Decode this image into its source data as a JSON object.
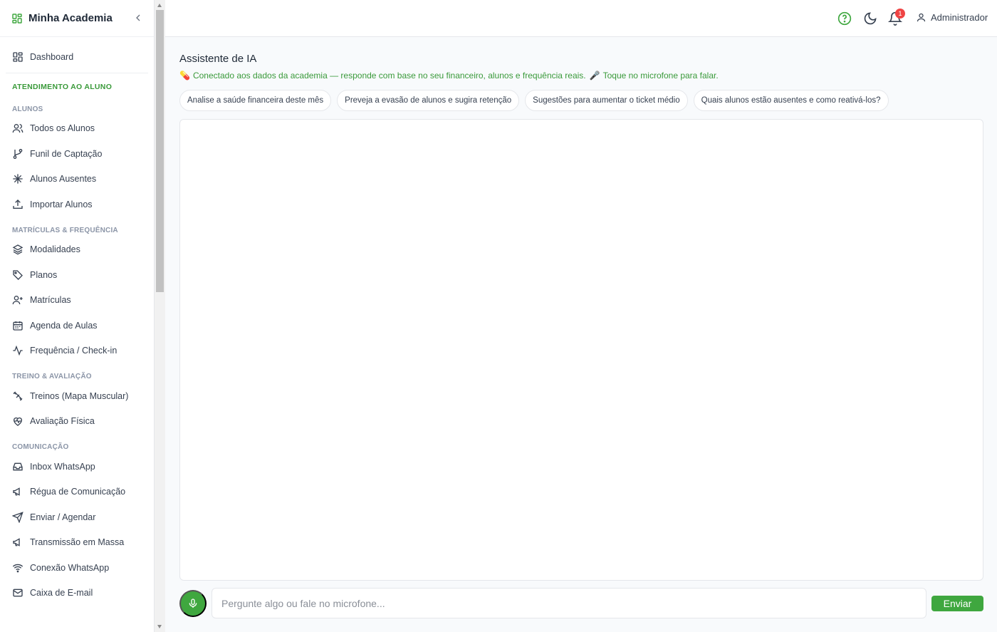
{
  "brand": {
    "name": "Minha Academia"
  },
  "colors": {
    "accent": "#3fa73f",
    "section": "#3a9a3a",
    "badge": "#ef4444"
  },
  "sidebar": {
    "dashboard": "Dashboard",
    "main_section": "ATENDIMENTO AO ALUNO",
    "groups": [
      {
        "title": "ALUNOS",
        "items": [
          {
            "label": "Todos os Alunos",
            "icon": "users-icon"
          },
          {
            "label": "Funil de Captação",
            "icon": "git-branch-icon"
          },
          {
            "label": "Alunos Ausentes",
            "icon": "snowflake-icon"
          },
          {
            "label": "Importar Alunos",
            "icon": "upload-icon"
          }
        ]
      },
      {
        "title": "MATRÍCULAS & FREQUÊNCIA",
        "items": [
          {
            "label": "Modalidades",
            "icon": "layers-icon"
          },
          {
            "label": "Planos",
            "icon": "tag-icon"
          },
          {
            "label": "Matrículas",
            "icon": "user-plus-icon"
          },
          {
            "label": "Agenda de Aulas",
            "icon": "calendar-icon"
          },
          {
            "label": "Frequência / Check-in",
            "icon": "activity-icon"
          }
        ]
      },
      {
        "title": "TREINO & AVALIAÇÃO",
        "items": [
          {
            "label": "Treinos (Mapa Muscular)",
            "icon": "dumbbell-icon"
          },
          {
            "label": "Avaliação Física",
            "icon": "heart-pulse-icon"
          }
        ]
      },
      {
        "title": "COMUNICAÇÃO",
        "items": [
          {
            "label": "Inbox WhatsApp",
            "icon": "inbox-icon"
          },
          {
            "label": "Régua de Comunicação",
            "icon": "megaphone-icon"
          },
          {
            "label": "Enviar / Agendar",
            "icon": "send-icon"
          },
          {
            "label": "Transmissão em Massa",
            "icon": "megaphone-icon"
          },
          {
            "label": "Conexão WhatsApp",
            "icon": "wifi-icon"
          },
          {
            "label": "Caixa de E-mail",
            "icon": "mail-icon"
          }
        ]
      }
    ]
  },
  "header": {
    "notifications_count": "1",
    "user": "Administrador"
  },
  "main": {
    "title": "Assistente de IA",
    "subtitle_part1": "Conectado aos dados da academia — responde com base no seu financeiro, alunos e frequência reais.",
    "subtitle_part2": "Toque no microfone para falar.",
    "chips": [
      "Analise a saúde financeira deste mês",
      "Preveja a evasão de alunos e sugira retenção",
      "Sugestões para aumentar o ticket médio",
      "Quais alunos estão ausentes e como reativá-los?"
    ],
    "input_placeholder": "Pergunte algo ou fale no microfone...",
    "send_label": "Enviar"
  }
}
